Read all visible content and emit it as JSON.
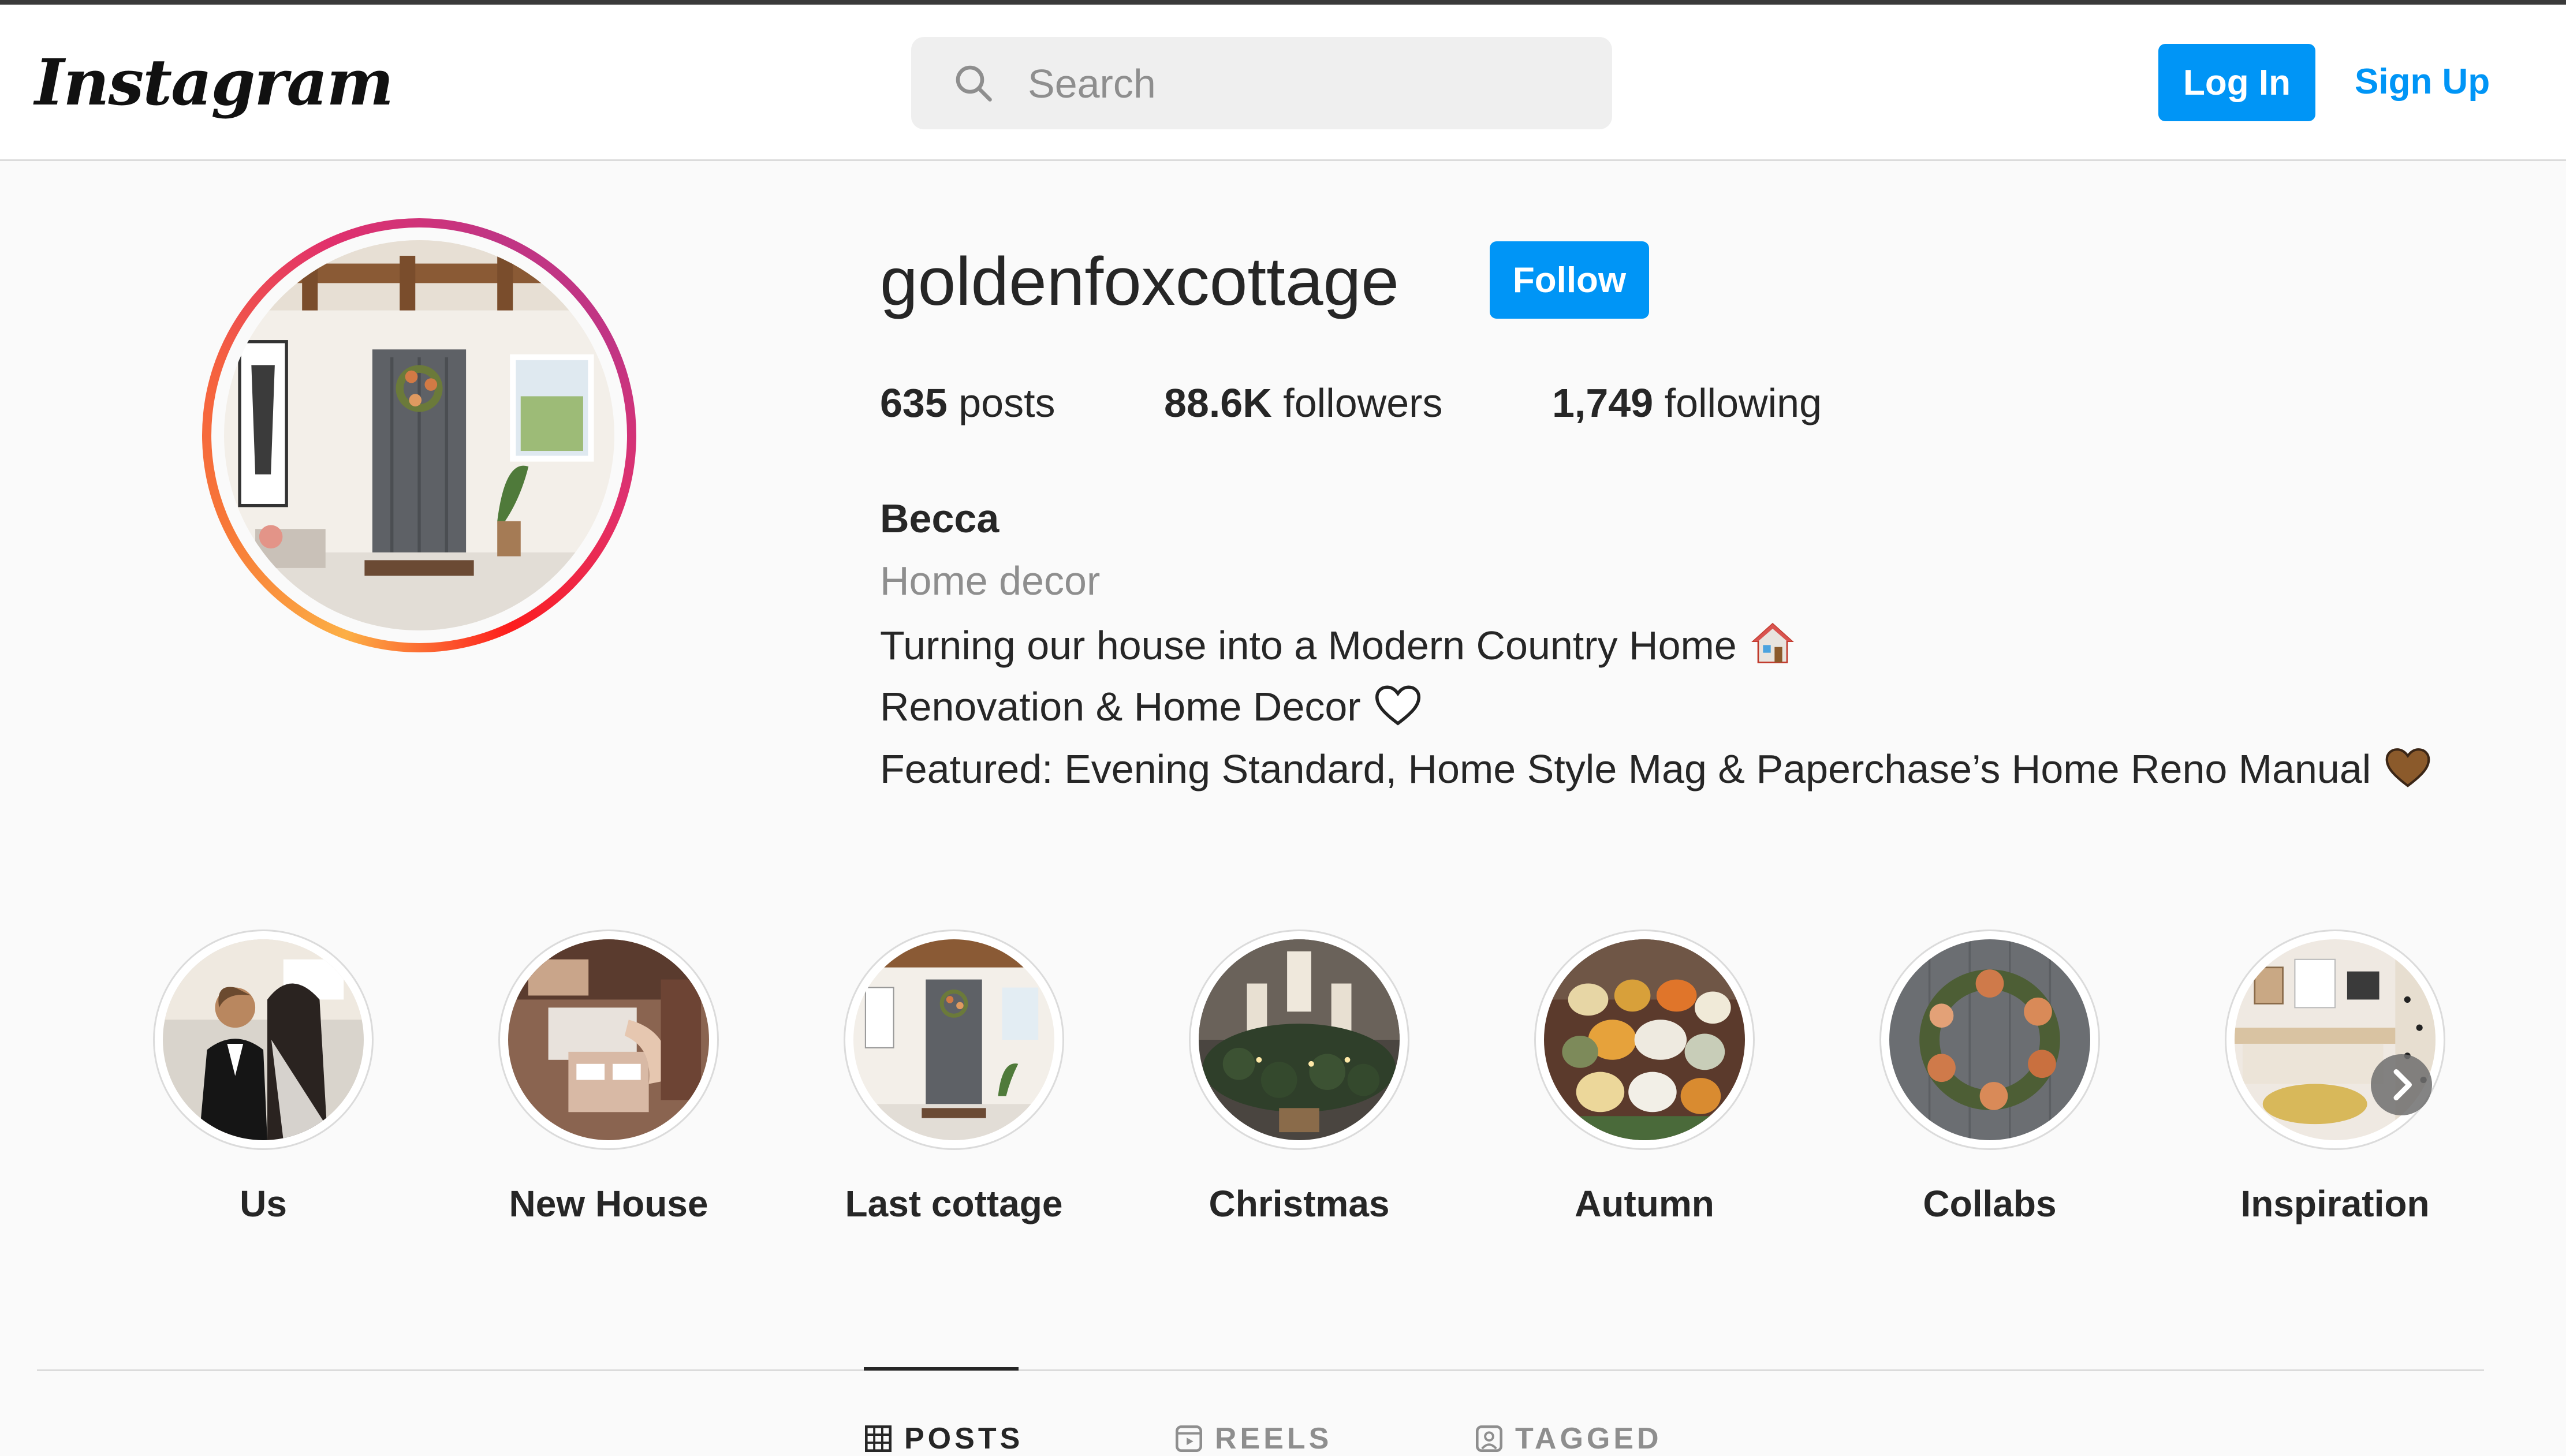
{
  "header": {
    "logo_text": "Instagram",
    "search_placeholder": "Search",
    "login_label": "Log In",
    "signup_label": "Sign Up"
  },
  "profile": {
    "username": "goldenfoxcottage",
    "follow_label": "Follow",
    "stats": {
      "posts_count": "635",
      "posts_label": "posts",
      "followers_count": "88.6K",
      "followers_label": "followers",
      "following_count": "1,749",
      "following_label": "following"
    },
    "bio": {
      "name": "Becca",
      "category": "Home decor",
      "line1": "Turning our house into a Modern Country Home",
      "line1_icon": "house-icon",
      "line2": "Renovation & Home Decor",
      "line2_icon": "white-heart-icon",
      "line3": "Featured: Evening Standard, Home Style Mag & Paperchase’s Home Reno Manual",
      "line3_icon": "brown-heart-icon"
    }
  },
  "highlights": [
    {
      "label": "Us"
    },
    {
      "label": "New House"
    },
    {
      "label": "Last cottage"
    },
    {
      "label": "Christmas"
    },
    {
      "label": "Autumn"
    },
    {
      "label": "Collabs"
    },
    {
      "label": "Inspiration"
    }
  ],
  "tabs": [
    {
      "label": "POSTS",
      "active": true
    },
    {
      "label": "REELS",
      "active": false
    },
    {
      "label": "TAGGED",
      "active": false
    }
  ],
  "colors": {
    "accent": "#0095f6",
    "text": "#262626",
    "secondary_text": "#8e8e8e",
    "background": "#fafafa",
    "border": "#dbdbdb"
  }
}
